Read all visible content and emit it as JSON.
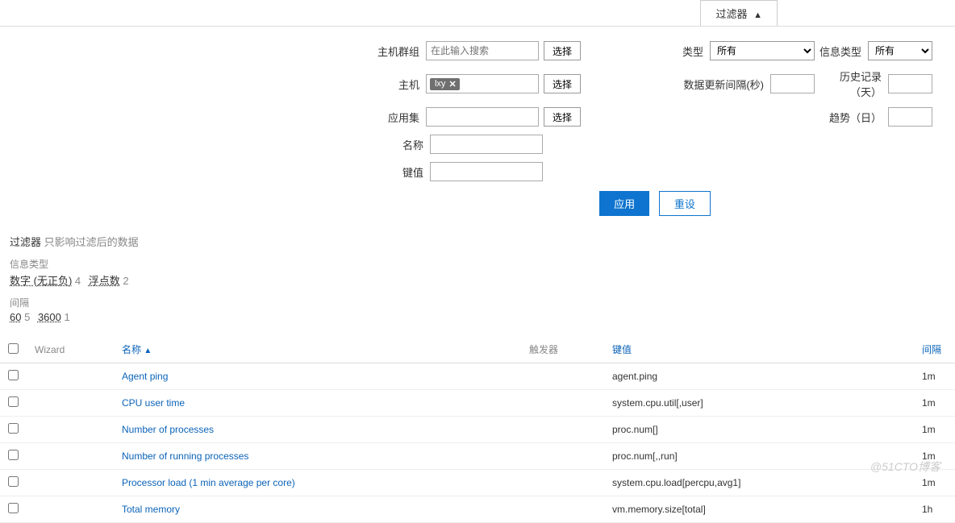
{
  "filterTab": {
    "label": "过滤器",
    "arrow": "▲"
  },
  "form": {
    "hostGroup": {
      "label": "主机群组",
      "placeholder": "在此输入搜索",
      "selectBtn": "选择"
    },
    "host": {
      "label": "主机",
      "tag": "lxy",
      "selectBtn": "选择"
    },
    "appSet": {
      "label": "应用集",
      "value": "",
      "selectBtn": "选择"
    },
    "name": {
      "label": "名称",
      "value": ""
    },
    "key": {
      "label": "键值",
      "value": ""
    },
    "type": {
      "label": "类型",
      "selected": "所有"
    },
    "updateInterval": {
      "label": "数据更新间隔(秒)",
      "value": ""
    },
    "infoType": {
      "label": "信息类型",
      "selected": "所有"
    },
    "historyDays": {
      "label": "历史记录（天）",
      "value": ""
    },
    "trendDays": {
      "label": "趋势（日）",
      "value": ""
    },
    "applyBtn": "应用",
    "resetBtn": "重设"
  },
  "subFilter": {
    "title": "过滤器",
    "note": "只影响过滤后的数据",
    "infoType": {
      "label": "信息类型",
      "items": [
        {
          "text": "数字 (无正负)",
          "count": "4"
        },
        {
          "text": "浮点数",
          "count": "2"
        }
      ]
    },
    "interval": {
      "label": "间隔",
      "items": [
        {
          "text": "60",
          "count": "5"
        },
        {
          "text": "3600",
          "count": "1"
        }
      ]
    }
  },
  "table": {
    "headers": {
      "wizard": "Wizard",
      "name": "名称",
      "trigger": "触发器",
      "key": "键值",
      "interval": "间隔"
    },
    "sortArrow": "▲",
    "rows": [
      {
        "name": "Agent ping",
        "key": "agent.ping",
        "interval": "1m"
      },
      {
        "name": "CPU user time",
        "key": "system.cpu.util[,user]",
        "interval": "1m"
      },
      {
        "name": "Number of processes",
        "key": "proc.num[]",
        "interval": "1m"
      },
      {
        "name": "Number of running processes",
        "key": "proc.num[,,run]",
        "interval": "1m"
      },
      {
        "name": "Processor load (1 min average per core)",
        "key": "system.cpu.load[percpu,avg1]",
        "interval": "1m"
      },
      {
        "name": "Total memory",
        "key": "vm.memory.size[total]",
        "interval": "1h"
      }
    ]
  },
  "watermark": "@51CTO博客"
}
